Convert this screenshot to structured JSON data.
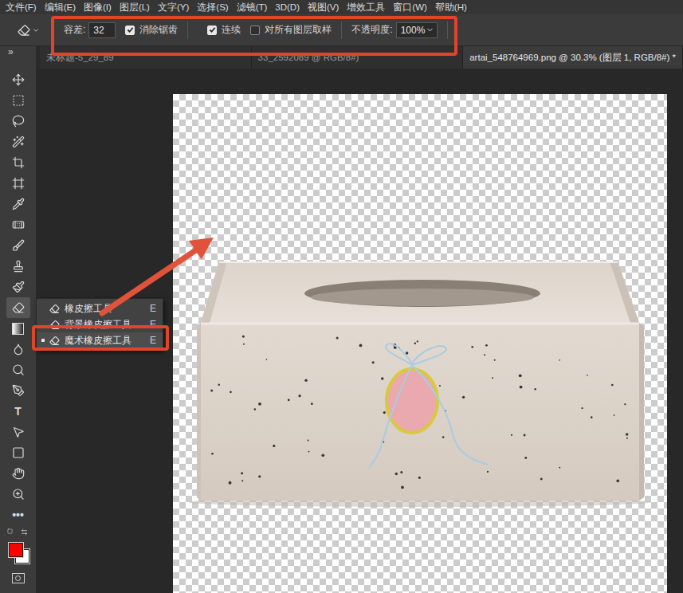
{
  "menu": [
    "文件(F)",
    "编辑(E)",
    "图像(I)",
    "图层(L)",
    "文字(Y)",
    "选择(S)",
    "滤镜(T)",
    "3D(D)",
    "视图(V)",
    "增效工具",
    "窗口(W)",
    "帮助(H)"
  ],
  "options": {
    "tolerance_label": "容差:",
    "tolerance": "32",
    "checks": [
      {
        "label": "消除锯齿",
        "checked": true
      },
      {
        "label": "连续",
        "checked": true
      },
      {
        "label": "对所有图层取样",
        "checked": false
      }
    ],
    "opacity_label": "不透明度:",
    "opacity": "100%"
  },
  "collapse_glyph": "»",
  "tabs": [
    {
      "label": "未标题-5_29_89",
      "selected": false
    },
    {
      "label": "33_2592089 @ RGB/8#)",
      "selected": false
    },
    {
      "label": "artai_548764969.png @ 30.3% (图层 1, RGB/8#) *",
      "selected": true
    }
  ],
  "tools": [
    {
      "selected": false
    },
    {
      "selected": false
    },
    {
      "selected": false
    },
    {
      "selected": false
    },
    {
      "selected": false
    },
    {
      "selected": false
    },
    {
      "selected": false
    },
    {
      "selected": false
    },
    {
      "selected": false
    },
    {
      "selected": false
    },
    {
      "selected": false
    },
    {
      "selected": true
    },
    {
      "selected": false
    },
    {
      "selected": false
    },
    {
      "selected": false
    },
    {
      "selected": false
    },
    {
      "selected": false,
      "glyph": "T"
    },
    {
      "selected": false
    },
    {
      "selected": false
    },
    {
      "selected": false
    },
    {
      "selected": false
    },
    {
      "selected": false,
      "glyph": "•••"
    }
  ],
  "swatches": {
    "foreground": "#ff0000",
    "background": "#ffffff"
  },
  "flyout": [
    {
      "label": "橡皮擦工具",
      "shortcut": "E",
      "selected": false
    },
    {
      "label": "背景橡皮擦工具",
      "shortcut": "E",
      "selected": false
    },
    {
      "label": "魔术橡皮擦工具",
      "shortcut": "E",
      "selected": true
    }
  ]
}
